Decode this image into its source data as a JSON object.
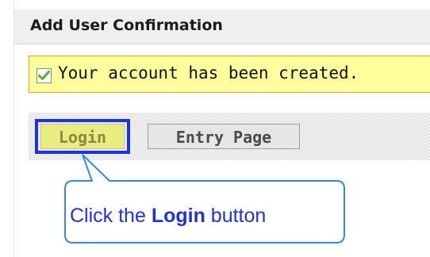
{
  "header": {
    "title": "Add User Confirmation"
  },
  "banner": {
    "icon": "check-icon",
    "message": "Your account has been created.",
    "colors": {
      "background": "#ffff9e",
      "border": "#f0a020",
      "check": "#5cae2e"
    }
  },
  "buttons": {
    "login_label": "Login",
    "entry_page_label": "Entry Page"
  },
  "callout": {
    "prefix": "Click the ",
    "emphasis": "Login",
    "suffix": " button",
    "colors": {
      "text": "#1e32e0",
      "border": "#2f8bea",
      "highlight": "#1a33e6"
    }
  }
}
